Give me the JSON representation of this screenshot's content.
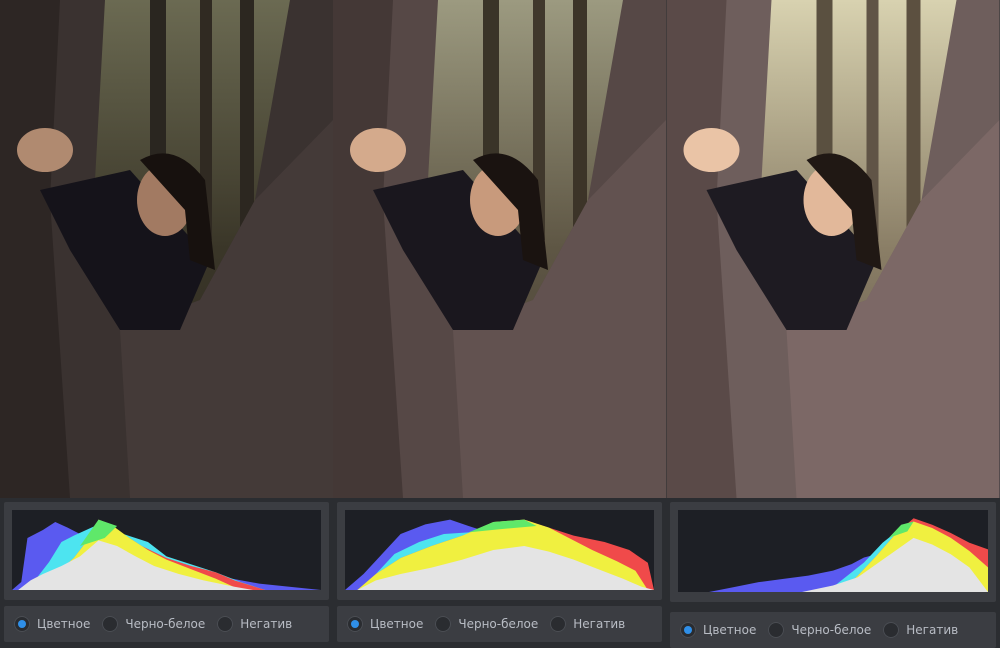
{
  "colors": {
    "background": "#2b2d31",
    "panel": "#3b3d42",
    "plot_bg": "#1d1f25",
    "radio_selected": "#2f8fe8",
    "hist_blue": "#5a5af0",
    "hist_cyan": "#4de4f0",
    "hist_green": "#5fe86a",
    "hist_yellow": "#f0f040",
    "hist_red": "#f04a4a",
    "hist_white": "#e4e4e4"
  },
  "panels": [
    {
      "variant": "dark",
      "modes": [
        {
          "label": "Цветное",
          "selected": true
        },
        {
          "label": "Черно-белое",
          "selected": false
        },
        {
          "label": "Негатив",
          "selected": false
        }
      ]
    },
    {
      "variant": "balanced",
      "modes": [
        {
          "label": "Цветное",
          "selected": true
        },
        {
          "label": "Черно-белое",
          "selected": false
        },
        {
          "label": "Негатив",
          "selected": false
        }
      ]
    },
    {
      "variant": "bright",
      "modes": [
        {
          "label": "Цветное",
          "selected": true
        },
        {
          "label": "Черно-белое",
          "selected": false
        },
        {
          "label": "Негатив",
          "selected": false
        }
      ]
    }
  ],
  "icons": [
    "radio-selected-icon",
    "radio-unselected-icon"
  ]
}
